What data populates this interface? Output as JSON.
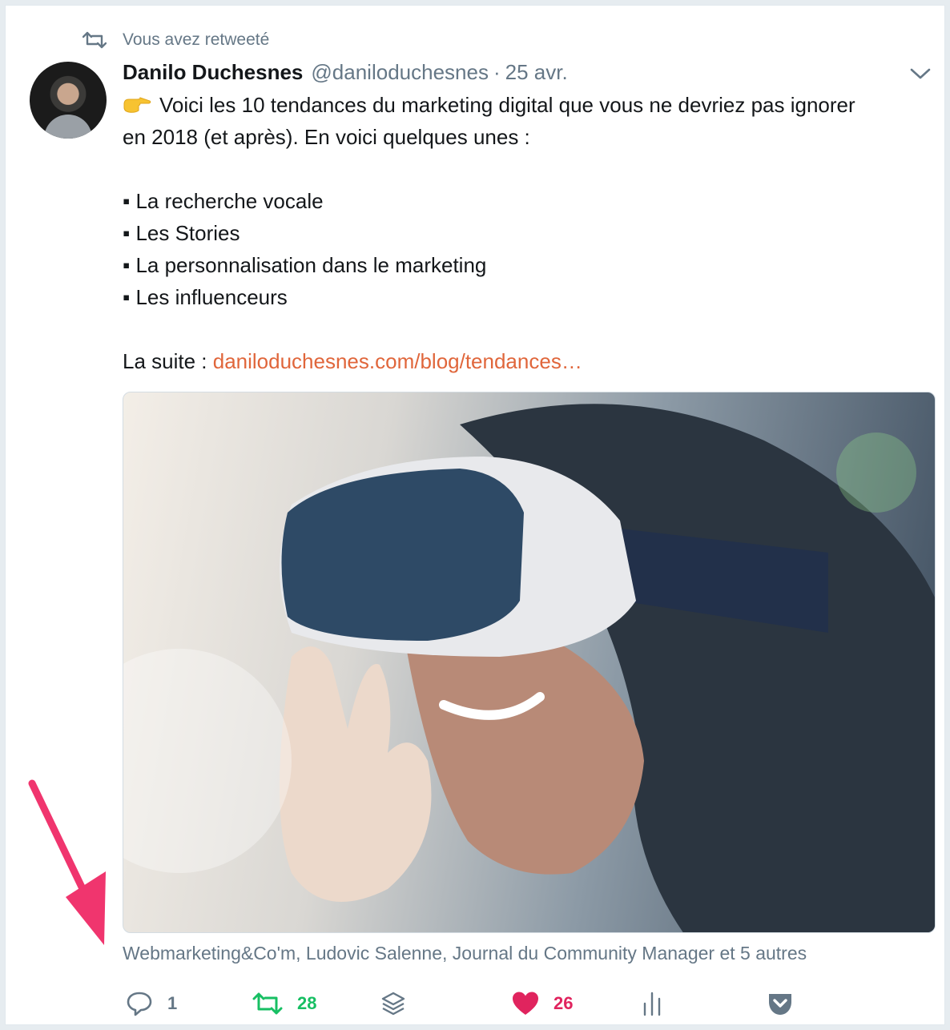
{
  "retweet_banner": {
    "label": "Vous avez retweeté"
  },
  "tweet": {
    "author_name": "Danilo Duchesnes",
    "handle": "@daniloduchesnes",
    "separator": "·",
    "date": "25 avr.",
    "lines": {
      "l1": "Voici les 10 tendances du marketing digital que vous ne devriez pas ignorer",
      "l2": "en 2018 (et après). En voici quelques unes :",
      "b1": "▪ La recherche vocale",
      "b2": "▪ Les Stories",
      "b3": "▪ La personnalisation dans le marketing",
      "b4": "▪ Les influenceurs",
      "suite": "La suite : "
    },
    "link_text": "daniloduchesnes.com/blog/tendances…",
    "tagged_users": "Webmarketing&Co'm, Ludovic Salenne, Journal du Community Manager et 5 autres"
  },
  "actions": {
    "reply_count": "1",
    "retweet_count": "28",
    "like_count": "26"
  },
  "colors": {
    "link": "#e0663b",
    "retweet_green": "#17bf63",
    "like_red": "#e0245e",
    "secondary_text": "#657786",
    "annotation_arrow": "#f0356e"
  },
  "icons": [
    "retweet-icon",
    "avatar",
    "caret-down-icon",
    "pointing-hand-emoji",
    "reply-icon",
    "retweet-icon",
    "layers-icon",
    "heart-icon",
    "analytics-icon",
    "pocket-icon",
    "annotation-arrow"
  ]
}
